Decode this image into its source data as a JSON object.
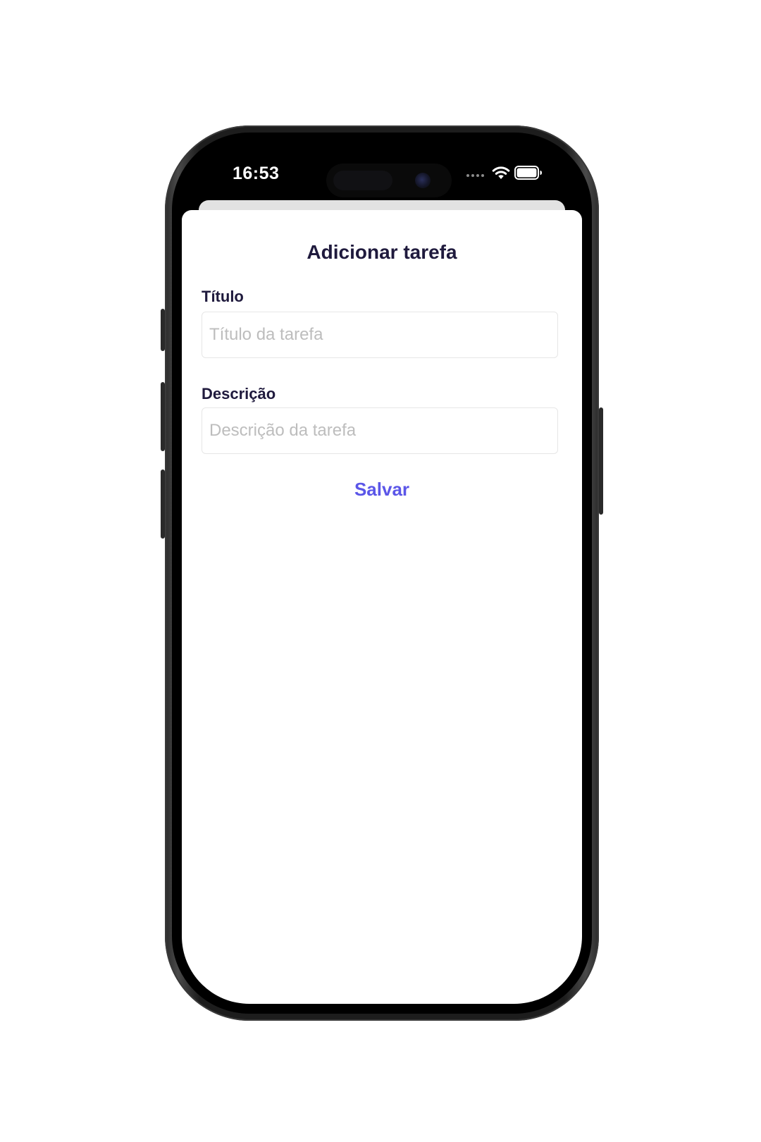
{
  "status_bar": {
    "time": "16:53"
  },
  "sheet": {
    "title": "Adicionar tarefa",
    "title_field": {
      "label": "Título",
      "placeholder": "Título da tarefa",
      "value": ""
    },
    "description_field": {
      "label": "Descrição",
      "placeholder": "Descrição da tarefa",
      "value": ""
    },
    "save_label": "Salvar"
  },
  "colors": {
    "accent": "#5b56e8",
    "heading": "#1f1a3d",
    "placeholder": "#bdbdbd",
    "sheet_background": "#ffffff",
    "sheet_behind": "#e2e2e2"
  },
  "icons": {
    "wifi": "wifi-icon",
    "battery": "battery-icon",
    "signal": "signal-dots-icon"
  }
}
